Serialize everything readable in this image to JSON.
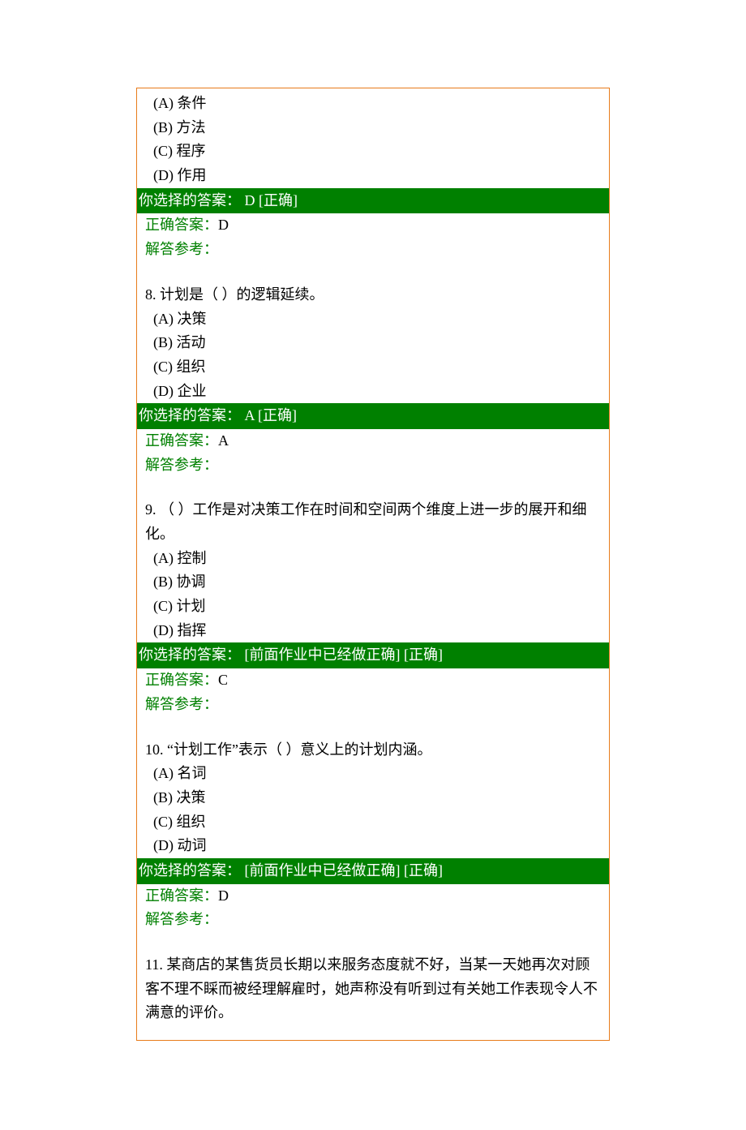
{
  "labels": {
    "chosen_prefix": "你选择的答案：",
    "correct_prefix": "正确答案：",
    "explain_prefix": "解答参考："
  },
  "questions": [
    {
      "number": "",
      "stem": "",
      "options": [
        "(A) 条件",
        "(B) 方法",
        "(C) 程序",
        "(D) 作用"
      ],
      "chosen": " D  [正确]",
      "correct": "D",
      "explain": ""
    },
    {
      "number": "8. ",
      "stem": "计划是（      ）的逻辑延续。",
      "options": [
        "(A) 决策",
        "(B) 活动",
        "(C) 组织",
        "(D) 企业"
      ],
      "chosen": " A  [正确]",
      "correct": "A",
      "explain": ""
    },
    {
      "number": "9. ",
      "stem": "（      ）工作是对决策工作在时间和空间两个维度上进一步的展开和细化。",
      "options": [
        "(A) 控制",
        "(B) 协调",
        "(C) 计划",
        "(D) 指挥"
      ],
      "chosen": " [前面作业中已经做正确]  [正确]",
      "correct": "C",
      "explain": ""
    },
    {
      "number": "10. ",
      "stem": "“计划工作”表示（      ）意义上的计划内涵。",
      "options": [
        "(A) 名词",
        "(B) 决策",
        "(C) 组织",
        "(D) 动词"
      ],
      "chosen": " [前面作业中已经做正确]  [正确]",
      "correct": "D",
      "explain": ""
    },
    {
      "number": "11. ",
      "stem": "某商店的某售货员长期以来服务态度就不好，当某一天她再次对顾客不理不睬而被经理解雇时，她声称没有听到过有关她工作表现令人不满意的评价。",
      "options": [],
      "chosen": null,
      "correct": null,
      "explain": null
    }
  ]
}
